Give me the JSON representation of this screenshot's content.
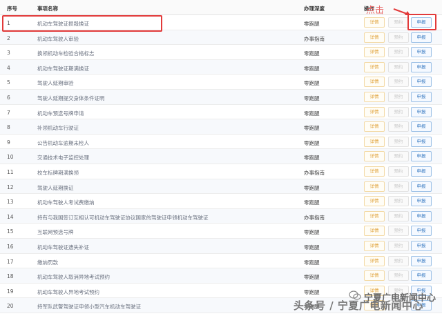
{
  "header": {
    "col_index": "序号",
    "col_name": "事项名称",
    "col_type": "办理深度",
    "col_action": "操作"
  },
  "buttons": {
    "detail": "详情",
    "book": "预约",
    "apply": "申报"
  },
  "annotation": {
    "click_text": "点击",
    "highlight_color": "#e23a3a"
  },
  "rows": [
    {
      "index": "1",
      "name": "机动车驾驶证损毁换证",
      "type": "零跑腿"
    },
    {
      "index": "2",
      "name": "机动车驾驶人审验",
      "type": "办事指南"
    },
    {
      "index": "3",
      "name": "换领机动车检验合格标志",
      "type": "零跑腿"
    },
    {
      "index": "4",
      "name": "机动车驾驶证期满换证",
      "type": "零跑腿"
    },
    {
      "index": "5",
      "name": "驾驶人延期审验",
      "type": "零跑腿"
    },
    {
      "index": "6",
      "name": "驾驶人延期提交身体条件证明",
      "type": "零跑腿"
    },
    {
      "index": "7",
      "name": "机动车预选号牌申请",
      "type": "零跑腿"
    },
    {
      "index": "8",
      "name": "补领机动车行驶证",
      "type": "零跑腿"
    },
    {
      "index": "9",
      "name": "公告机动车逾期未检人",
      "type": "零跑腿"
    },
    {
      "index": "10",
      "name": "交通技术电子监控处理",
      "type": "零跑腿"
    },
    {
      "index": "11",
      "name": "校车标牌期满换领",
      "type": "办事指南"
    },
    {
      "index": "12",
      "name": "驾驶人延期换证",
      "type": "零跑腿"
    },
    {
      "index": "13",
      "name": "机动车驾驶人考试费缴纳",
      "type": "零跑腿"
    },
    {
      "index": "14",
      "name": "持有与我国签订互相认可机动车驾驶证协议国家的驾驶证申领机动车驾驶证",
      "type": "办事指南"
    },
    {
      "index": "15",
      "name": "互联网预选号牌",
      "type": "零跑腿"
    },
    {
      "index": "16",
      "name": "机动车驾驶证遗失补证",
      "type": "零跑腿"
    },
    {
      "index": "17",
      "name": "缴纳罚款",
      "type": "零跑腿"
    },
    {
      "index": "18",
      "name": "机动车驾驶人取消异地考试预约",
      "type": "零跑腿"
    },
    {
      "index": "19",
      "name": "机动车驾驶人异地考试预约",
      "type": "零跑腿"
    },
    {
      "index": "20",
      "name": "持军队武警驾驶证申领小型汽车机动车驾驶证",
      "type": "零跑腿"
    }
  ],
  "watermark": {
    "line1": "宁夏广电新闻中心",
    "line2": "头条号 / 宁夏广电新闻中心",
    "icon": "wechat-icon"
  }
}
